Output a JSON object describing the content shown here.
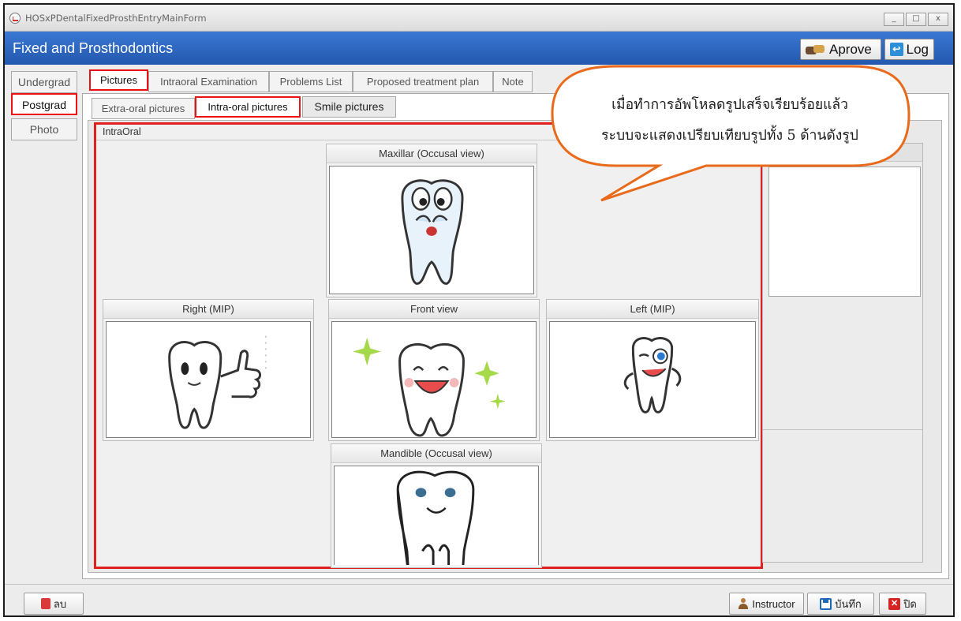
{
  "window": {
    "title": "HOSxPDentalFixedProsthEntryMainForm",
    "controls": [
      "_",
      "□",
      "x"
    ]
  },
  "header": {
    "title": "Fixed and Prosthodontics",
    "approve_label": "Aprove",
    "log_label": "Log"
  },
  "side_tabs": [
    {
      "label": "Undergrad",
      "selected": false
    },
    {
      "label": "Postgrad",
      "selected": true
    },
    {
      "label": "Photo",
      "selected": false
    }
  ],
  "main_tabs": [
    {
      "label": "Pictures",
      "selected": true
    },
    {
      "label": "Intraoral Examination",
      "selected": false
    },
    {
      "label": "Problems List",
      "selected": false
    },
    {
      "label": "Proposed treatment plan",
      "selected": false
    },
    {
      "label": "Note",
      "selected": false
    }
  ],
  "sub_tabs": [
    {
      "label": "Extra-oral pictures",
      "selected": false
    },
    {
      "label": "Intra-oral pictures",
      "selected": true
    },
    {
      "label": "Smile pictures",
      "selected": false
    }
  ],
  "intraoral": {
    "title": "IntraOral",
    "views": {
      "maxillar": "Maxillar (Occusal view)",
      "right": "Right (MIP)",
      "front": "Front view",
      "left": "Left (MIP)",
      "mandible": "Mandible (Occusal view)"
    }
  },
  "callout": {
    "line1": "เมื่อทำการอัพโหลดรูปเสร็จเรียบร้อยแล้ว",
    "line2": "ระบบจะแสดงเปรียบเทียบรูปทั้ง 5 ด้านดังรูป"
  },
  "footer": {
    "delete_label": "ลบ",
    "instructor_label": "Instructor",
    "save_label": "บันทึก",
    "close_label": "ปิด"
  },
  "colors": {
    "header_blue": "#2d64bd",
    "highlight_red": "#e11d1d",
    "callout_orange": "#e86a1a"
  },
  "icons": {
    "approve": "handshake-icon",
    "log": "log-icon",
    "delete": "trash-icon",
    "instructor": "user-icon",
    "save": "save-icon",
    "close": "close-icon"
  }
}
